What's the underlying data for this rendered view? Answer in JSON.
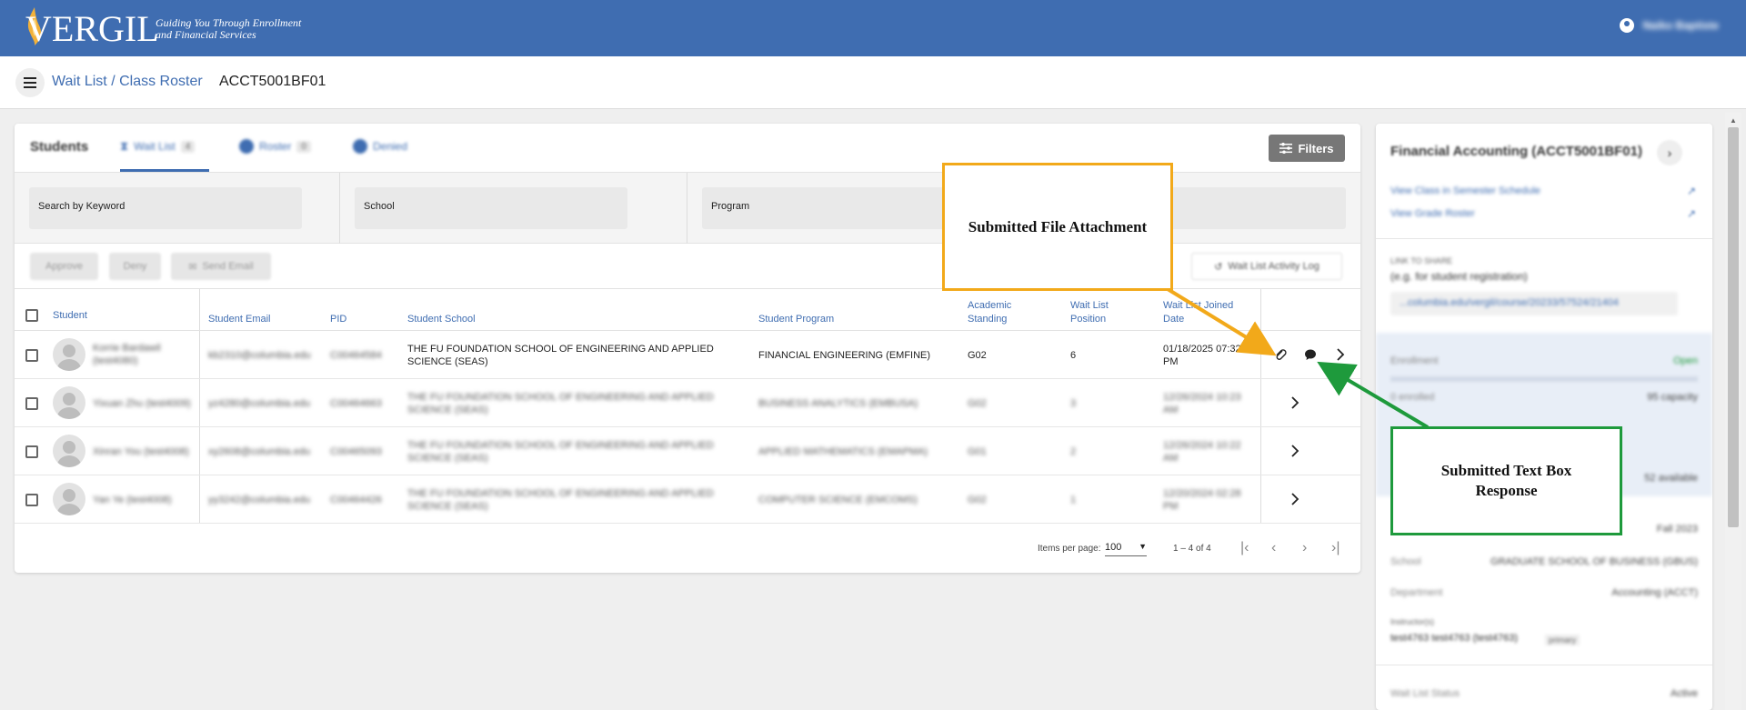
{
  "header": {
    "logo_text": "VERGIL",
    "tagline_line1": "Guiding You Through Enrollment",
    "tagline_line2": "and Financial Services",
    "user_name": "Naiko Baptiste",
    "user_icon": "account-circle-icon"
  },
  "breadcrumb": {
    "menu_icon": "hamburger-menu-icon",
    "link": "Wait List / Class Roster",
    "code": "ACCT5001BF01"
  },
  "tabs": {
    "title": "Students",
    "items": [
      {
        "label": "Wait List",
        "count": "4"
      },
      {
        "label": "Roster",
        "count": "0"
      },
      {
        "label": "Denied",
        "count": ""
      }
    ],
    "filters_label": "Filters"
  },
  "search": {
    "keyword": "Search by Keyword",
    "school": "School",
    "program": "Program"
  },
  "actions": {
    "approve": "Approve",
    "deny": "Deny",
    "send_email": "Send Email",
    "activity_log": "Wait List Activity Log"
  },
  "table": {
    "columns": [
      "Student",
      "Student Email",
      "PID",
      "Student School",
      "Student Program",
      "Academic Standing",
      "Wait List Position",
      "Wait List Joined Date"
    ],
    "rows": [
      {
        "student": "Korrie Bardawil (test4080)",
        "email": "kb2310@columbia.edu",
        "pid": "C00464584",
        "school": "THE FU FOUNDATION SCHOOL OF ENGINEERING AND APPLIED SCIENCE (SEAS)",
        "program": "FINANCIAL ENGINEERING (EMFINE)",
        "standing": "G02",
        "position": "6",
        "joined": "01/18/2025 07:32 PM"
      },
      {
        "student": "Yixuan Zhu (test4009)",
        "email": "yz4280@columbia.edu",
        "pid": "C00464663",
        "school": "THE FU FOUNDATION SCHOOL OF ENGINEERING AND APPLIED SCIENCE (SEAS)",
        "program": "BUSINESS ANALYTICS (EMBUSA)",
        "standing": "G02",
        "position": "3",
        "joined": "12/26/2024 10:23 AM"
      },
      {
        "student": "Xinran You (test4008)",
        "email": "xy2608@columbia.edu",
        "pid": "C00465093",
        "school": "THE FU FOUNDATION SCHOOL OF ENGINEERING AND APPLIED SCIENCE (SEAS)",
        "program": "APPLIED MATHEMATICS (EMAPMA)",
        "standing": "G01",
        "position": "2",
        "joined": "12/26/2024 10:22 AM"
      },
      {
        "student": "Yan Ye (test4008)",
        "email": "yy3242@columbia.edu",
        "pid": "C00464426",
        "school": "THE FU FOUNDATION SCHOOL OF ENGINEERING AND APPLIED SCIENCE (SEAS)",
        "program": "COMPUTER SCIENCE (EMCOMS)",
        "standing": "G02",
        "position": "1",
        "joined": "12/20/2024 02:28 PM"
      }
    ]
  },
  "paginator": {
    "items_label": "Items per page:",
    "items_value": "100",
    "range": "1 – 4 of 4"
  },
  "side": {
    "title": "Financial Accounting (ACCT5001BF01)",
    "link1": "View Class in Semester Schedule",
    "link2": "View Grade Roster",
    "link_label": "LINK TO SHARE",
    "link_hint": "(e.g. for student registration)",
    "url": "...columbia.edu/vergil/course/20233/57524/21404",
    "enrollment_label": "Enrollment",
    "enrollment_status": "Open",
    "enrolled": "0 enrolled",
    "capacity": "95 capacity",
    "available": "52 available",
    "term": "Fall 2023",
    "school_label": "School",
    "school": "GRADUATE SCHOOL OF BUSINESS (GBUS)",
    "dept_label": "Department",
    "dept": "Accounting (ACCT)",
    "instructor_label": "Instructor(s)",
    "instructor": "test4763 test4763 (test4763)",
    "instructor_tag": "primary",
    "status_label": "Wait List Status",
    "status": "Active"
  },
  "callouts": {
    "file": "Submitted File Attachment",
    "text_line1": "Submitted Text Box",
    "text_line2": "Response"
  },
  "colors": {
    "brand_blue": "#3f6db1",
    "callout_orange": "#f2a91a",
    "callout_green": "#1e9a3c"
  }
}
